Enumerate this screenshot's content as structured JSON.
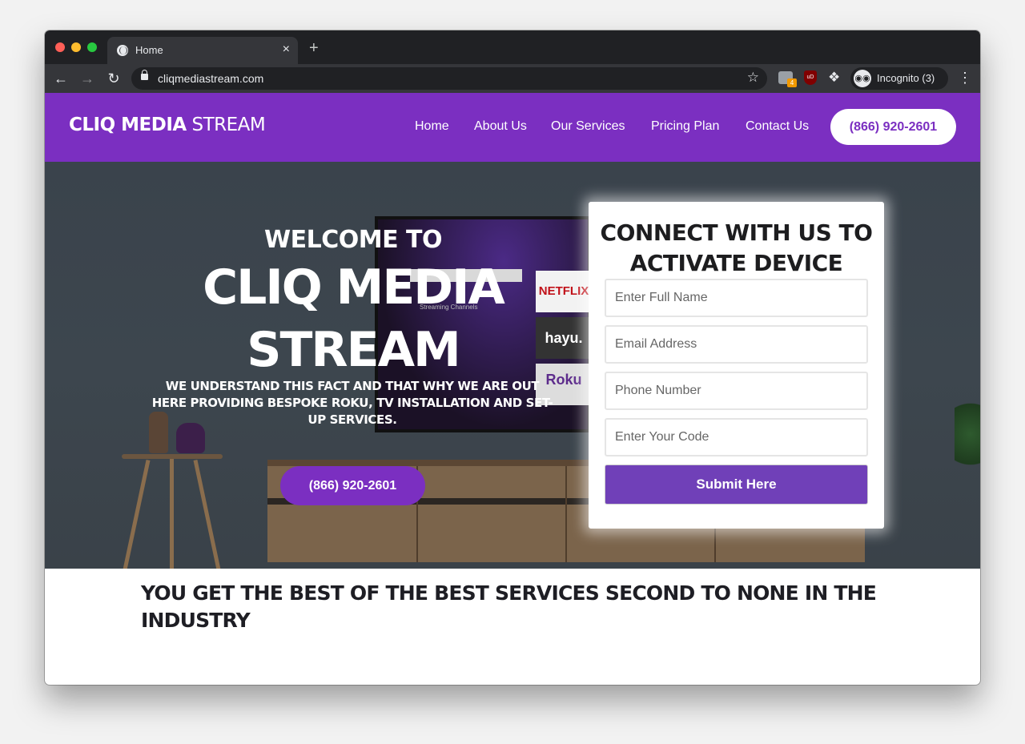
{
  "browser": {
    "tab_title": "Home",
    "tab_close": "×",
    "new_tab": "+",
    "url": "cliqmediastream.com",
    "ext_badge": "4",
    "ext_ublock": "uD",
    "incognito_label": "Incognito (3)"
  },
  "site": {
    "logo_bold": "CLIQ MEDIA",
    "logo_light": " STREAM",
    "nav": [
      "Home",
      "About Us",
      "Our Services",
      "Pricing Plan",
      "Contact Us"
    ],
    "header_phone": "(866) 920-2601"
  },
  "hero": {
    "welcome": "WELCOME TO",
    "title_line1": "CLIQ MEDIA",
    "title_line2": "STREAM",
    "subtitle": "WE UNDERSTAND THIS FACT AND THAT WHY WE ARE OUT HERE PROVIDING BESPOKE ROKU, TV INSTALLATION AND SET-UP SERVICES.",
    "phone_button": "(866) 920-2601",
    "tv": {
      "netflix": "NETFLIX",
      "hayu": "hayu.",
      "roku": "Roku",
      "menu_text": "Streaming Channels"
    }
  },
  "form": {
    "title": "CONNECT WITH US TO ACTIVATE DEVICE",
    "fields": {
      "name_placeholder": "Enter Full Name",
      "email_placeholder": "Email Address",
      "phone_placeholder": "Phone Number",
      "code_placeholder": "Enter Your Code"
    },
    "submit_label": "Submit Here"
  },
  "section": {
    "heading": "YOU GET THE BEST OF THE BEST SERVICES SECOND TO NONE IN THE INDUSTRY"
  },
  "colors": {
    "brand_purple": "#7b2fc1",
    "submit_purple": "#7040b8",
    "chrome_dark": "#202124"
  }
}
